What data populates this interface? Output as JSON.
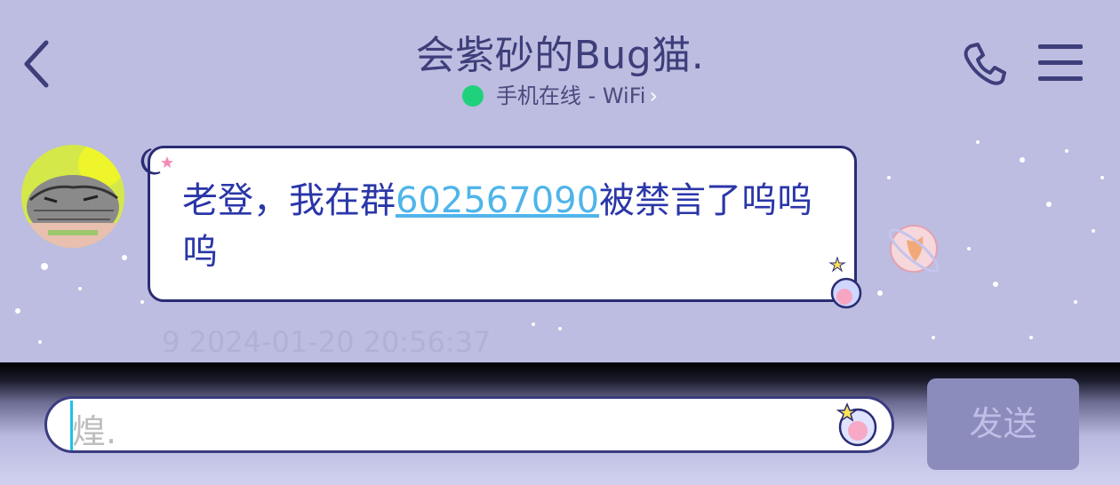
{
  "header": {
    "title": "会紫砂的Bug猫.",
    "status": "手机在线 - WiFi",
    "status_color": "#20d17b"
  },
  "message": {
    "text_before": "老登，我在群",
    "link": "602567090",
    "text_after": "被禁言了呜呜呜",
    "timestamp": "9 2024-01-20 20:56:37"
  },
  "input": {
    "placeholder": "煌."
  },
  "send_label": "发送",
  "icons": [
    "back-icon",
    "phone-icon",
    "menu-icon",
    "avatar",
    "emoji-icon"
  ]
}
